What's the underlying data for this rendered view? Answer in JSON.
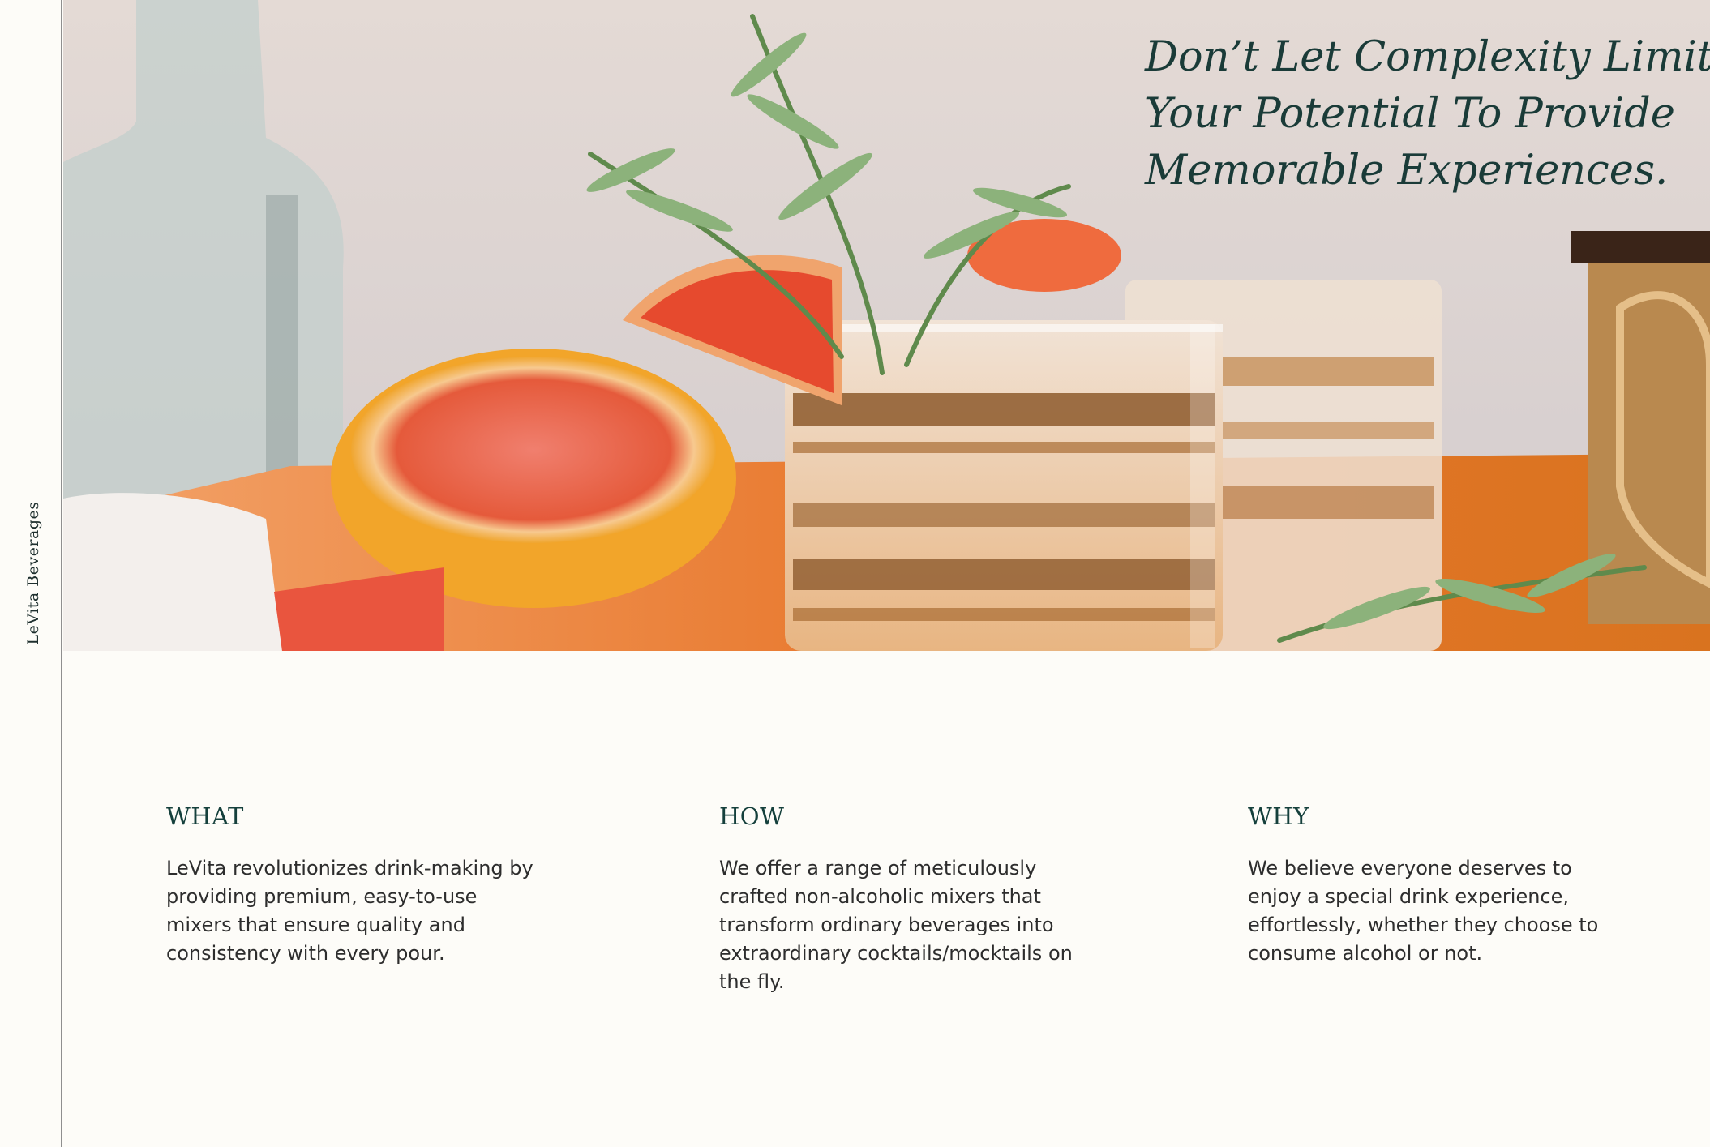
{
  "brand": {
    "name": "LeVita Beverages"
  },
  "hero": {
    "headline": "Don’t Let Complexity Limit Your Potential To Provide Memorable Experiences.",
    "image": "cocktail-with-grapefruit-and-rosemary"
  },
  "columns": [
    {
      "heading": "WHAT",
      "body": "LeVita revolutionizes drink-making by providing premium, easy-to-use mixers that ensure quality and consistency with every pour."
    },
    {
      "heading": "HOW",
      "body": "We offer a range of meticulously crafted non-alcoholic mixers that transform ordinary beverages into extraordinary cocktails/mocktails on the fly."
    },
    {
      "heading": "WHY",
      "body": "We believe everyone deserves to enjoy a special drink experience, effortlessly, whether they choose to consume alcohol or not."
    }
  ],
  "colors": {
    "accent": "#15403c",
    "background": "#fdfcf8",
    "rule": "#8f8f8f"
  }
}
